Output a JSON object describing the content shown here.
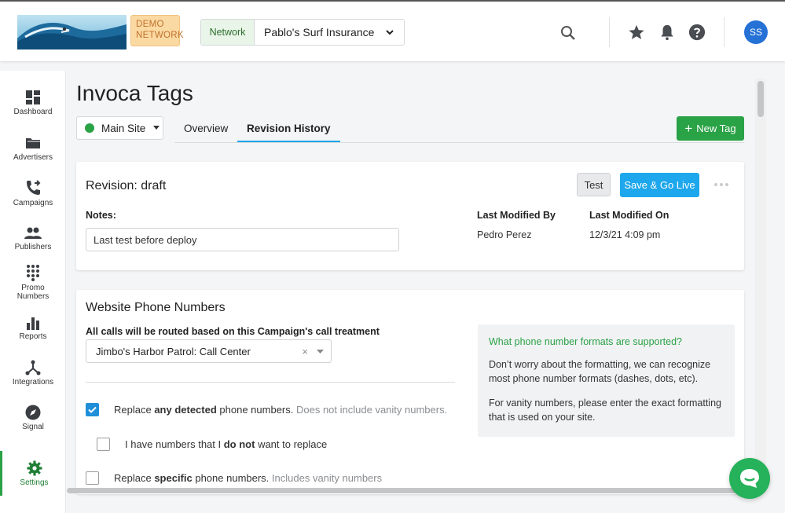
{
  "topbar": {
    "demo_badge": "DEMO NETWORK",
    "network_label": "Network",
    "network_value": "Pablo's Surf Insurance",
    "avatar_initials": "SS"
  },
  "sidebar": {
    "items": [
      {
        "label": "Dashboard",
        "icon": "dashboard-icon"
      },
      {
        "label": "Advertisers",
        "icon": "folder-icon"
      },
      {
        "label": "Campaigns",
        "icon": "phone-forward-icon"
      },
      {
        "label": "Publishers",
        "icon": "people-icon"
      },
      {
        "label": "Promo Numbers",
        "icon": "dialpad-icon"
      },
      {
        "label": "Reports",
        "icon": "bar-chart-icon"
      },
      {
        "label": "Integrations",
        "icon": "hub-icon"
      },
      {
        "label": "Signal",
        "icon": "compass-icon"
      },
      {
        "label": "Settings",
        "icon": "gear-icon",
        "active": true
      }
    ]
  },
  "page": {
    "title": "Invoca Tags",
    "site_select": "Main Site",
    "tabs": [
      {
        "label": "Overview",
        "active": false
      },
      {
        "label": "Revision History",
        "active": true
      }
    ],
    "new_tag_label": "New Tag"
  },
  "revision": {
    "title": "Revision: draft",
    "test_label": "Test",
    "golive_label": "Save & Go Live",
    "notes_label": "Notes:",
    "notes_value": "Last test before deploy",
    "last_modified_by_label": "Last Modified By",
    "last_modified_by": "Pedro Perez",
    "last_modified_on_label": "Last Modified On",
    "last_modified_on": "12/3/21 4:09 pm"
  },
  "website_numbers": {
    "title": "Website Phone Numbers",
    "route_label": "All calls will be routed based on this Campaign's call treatment",
    "treatment_value": "Jimbo's Harbor Patrol: Call Center",
    "options": [
      {
        "pre": "Replace ",
        "bold": "any detected",
        "post": " phone numbers.",
        "muted": " Does not include vanity numbers.",
        "checked": true
      },
      {
        "pre": "I have numbers that I ",
        "bold": "do not",
        "post": " want to replace",
        "muted": "",
        "checked": false
      },
      {
        "pre": "Replace ",
        "bold": "specific",
        "post": " phone numbers.",
        "muted": " Includes vanity numbers",
        "checked": false
      }
    ],
    "help_title": "What phone number formats are supported?",
    "help_text_1": "Don’t worry about the formatting, we can recognize most phone number formats (dashes, dots, etc).",
    "help_text_2": "For vanity numbers, please enter the exact formatting that is used on your site."
  },
  "colors": {
    "accent_green": "#2aa246",
    "accent_blue": "#1ea7ec",
    "avatar_blue": "#2571d6"
  }
}
